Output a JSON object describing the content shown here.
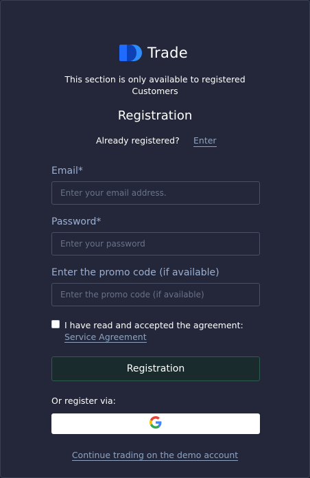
{
  "brand": {
    "name": "Trade",
    "accent": "#1f6bff"
  },
  "notice": {
    "line1": "This section is only available to registered",
    "line2": "Customers"
  },
  "title": "Registration",
  "login_prompt": {
    "text": "Already registered?",
    "link": "Enter"
  },
  "email": {
    "label": "Email*",
    "placeholder": "Enter your email address.",
    "value": ""
  },
  "password": {
    "label": "Password*",
    "placeholder": "Enter your password",
    "value": ""
  },
  "promo": {
    "label": "Enter the promo code (if available)",
    "placeholder": "Enter the promo code (if available)",
    "value": ""
  },
  "agreement": {
    "text": "I have read and accepted the agreement: ",
    "link": "Service Agreement",
    "checked": false
  },
  "register_button": "Registration",
  "social": {
    "label": "Or register via:",
    "google_icon": "google-icon"
  },
  "demo_link": "Continue trading on the demo account",
  "colors": {
    "background": "#232739",
    "label": "#9cb0d3",
    "link": "#8fa3c0",
    "button_bg": "#1a2b2e",
    "button_border": "#2f5a4f"
  }
}
